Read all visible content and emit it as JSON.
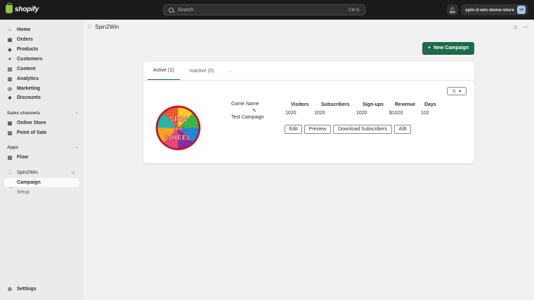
{
  "topbar": {
    "logo_text": "shopify",
    "search_placeholder": "Search",
    "search_shortcut": "Ctrl K",
    "store_name": "spin-2-win-demo-store",
    "store_initials": "sd"
  },
  "sidebar": {
    "items": [
      {
        "label": "Home",
        "icon": "home-icon"
      },
      {
        "label": "Orders",
        "icon": "orders-icon"
      },
      {
        "label": "Products",
        "icon": "tag-icon"
      },
      {
        "label": "Customers",
        "icon": "person-icon"
      },
      {
        "label": "Content",
        "icon": "content-icon"
      },
      {
        "label": "Analytics",
        "icon": "chart-icon"
      },
      {
        "label": "Marketing",
        "icon": "target-icon"
      },
      {
        "label": "Discounts",
        "icon": "discount-icon"
      }
    ],
    "sales_channels_label": "Sales channels",
    "channels": [
      {
        "label": "Online Store",
        "icon": "store-icon"
      },
      {
        "label": "Point of Sale",
        "icon": "pos-icon"
      }
    ],
    "apps_label": "Apps",
    "apps": [
      {
        "label": "Flow",
        "icon": "flow-icon"
      }
    ],
    "app_name": "Spin2Win",
    "app_subitems": [
      {
        "label": "Campaign"
      },
      {
        "label": "Setup"
      }
    ],
    "settings_label": "Settings"
  },
  "main": {
    "app_title": "Spin2Win",
    "new_campaign_label": "New Campaign",
    "tabs": [
      {
        "label": "Active (1)"
      },
      {
        "label": "Inactive (0)"
      },
      {
        "label": ".."
      }
    ],
    "campaign": {
      "game_name_label": "Game Name",
      "game_name_value": "Test Campaign",
      "wheel_text": [
        "SPIN",
        "THE",
        "WHEEL"
      ],
      "stats_headers": [
        "Visitors",
        "Subscribers",
        "Sign-ups",
        "Revenue",
        "Days"
      ],
      "stats_values": [
        "1020",
        "1020",
        "1020",
        "$1020",
        "102"
      ],
      "buttons": [
        "Edit",
        "Preview",
        "Download Subscribers",
        "A/B"
      ]
    }
  }
}
